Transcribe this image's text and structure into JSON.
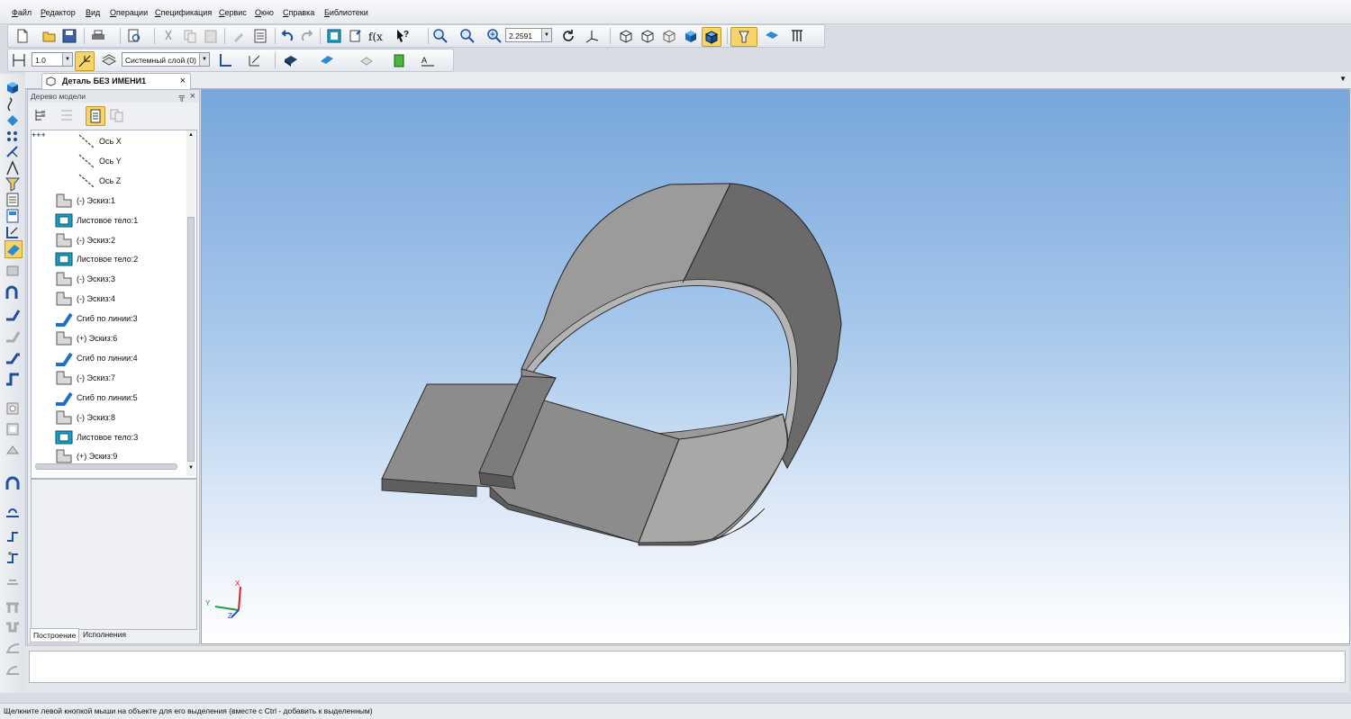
{
  "menu": [
    "Файл",
    "Редактор",
    "Вид",
    "Операции",
    "Спецификация",
    "Сервис",
    "Окно",
    "Справка",
    "Библиотеки"
  ],
  "toolbar1": {
    "zoom_value": "2.2591"
  },
  "toolbar2": {
    "step_value": "1.0",
    "layer_value": "Системный слой (0)"
  },
  "document_tab": {
    "title": "Деталь БЕЗ ИМЕНИ1",
    "close": "×"
  },
  "tree_panel": {
    "title": "Дерево модели",
    "pin": "ᵖ",
    "close": "×",
    "items": [
      {
        "label": "Ось X",
        "icon": "axis-icon"
      },
      {
        "label": "Ось Y",
        "icon": "axis-icon"
      },
      {
        "label": "Ось Z",
        "icon": "axis-icon"
      },
      {
        "label": "(-) Эскиз:1",
        "icon": "sketch-icon"
      },
      {
        "label": "Листовое тело:1",
        "icon": "sheet-body-icon"
      },
      {
        "label": "(-) Эскиз:2",
        "icon": "sketch-icon"
      },
      {
        "label": "Листовое тело:2",
        "icon": "sheet-body-icon"
      },
      {
        "label": "(-) Эскиз:3",
        "icon": "sketch-icon"
      },
      {
        "label": "(-) Эскиз:4",
        "icon": "sketch-icon"
      },
      {
        "label": "Сгиб по линии:3",
        "icon": "bend-icon",
        "expandable": "+"
      },
      {
        "label": "(+) Эскиз:6",
        "icon": "sketch-icon"
      },
      {
        "label": "Сгиб по линии:4",
        "icon": "bend-icon",
        "expandable": "+"
      },
      {
        "label": "(-) Эскиз:7",
        "icon": "sketch-icon"
      },
      {
        "label": "Сгиб по линии:5",
        "icon": "bend-icon",
        "expandable": "+"
      },
      {
        "label": "(-) Эскиз:8",
        "icon": "sketch-icon"
      },
      {
        "label": "Листовое тело:3",
        "icon": "sheet-body-icon"
      },
      {
        "label": "(+) Эскиз:9",
        "icon": "sketch-icon"
      }
    ],
    "tabs": [
      "Построение",
      "Исполнения"
    ]
  },
  "viewport": {
    "axis_labels": {
      "x": "X",
      "y": "Y",
      "z": "Z"
    },
    "colors": {
      "part_top": "#8c8c8c",
      "part_side": "#6e6e6e",
      "bg_top": "#77a7db",
      "bg_bottom": "#ffffff"
    }
  },
  "status_bar": {
    "text": "Щелкните левой кнопкой мыши на объекте для его выделения (вместе с Ctrl - добавить к выделенным)"
  }
}
